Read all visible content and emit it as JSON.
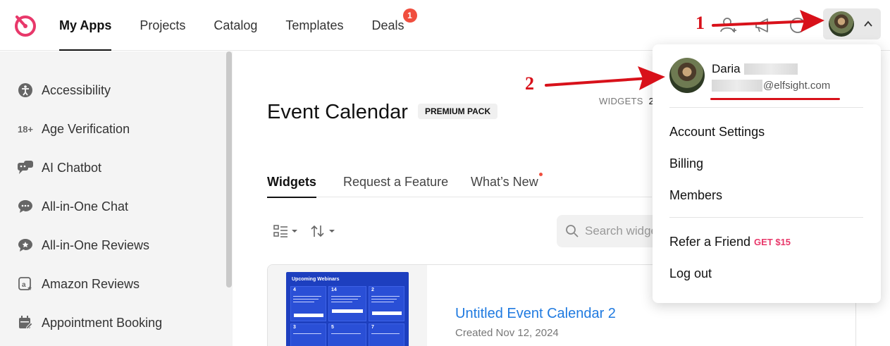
{
  "topbar": {
    "nav": [
      {
        "label": "My Apps",
        "active": true
      },
      {
        "label": "Projects",
        "active": false
      },
      {
        "label": "Catalog",
        "active": false
      },
      {
        "label": "Templates",
        "active": false
      },
      {
        "label": "Deals",
        "active": false
      }
    ],
    "deals_badge": "1",
    "icons": [
      "logo-icon",
      "add-user-icon",
      "megaphone-icon",
      "help-icon",
      "chevron-up-icon"
    ],
    "accent_color": "#e8386a"
  },
  "sidebar": {
    "items": [
      {
        "label": "Accessibility",
        "icon": "accessibility-icon"
      },
      {
        "label": "Age Verification",
        "icon": "age-18-icon",
        "icon_text": "18+"
      },
      {
        "label": "AI Chatbot",
        "icon": "chatbot-icon"
      },
      {
        "label": "All-in-One Chat",
        "icon": "chat-icon"
      },
      {
        "label": "All-in-One Reviews",
        "icon": "reviews-icon"
      },
      {
        "label": "Amazon Reviews",
        "icon": "amazon-icon"
      },
      {
        "label": "Appointment Booking",
        "icon": "calendar-edit-icon"
      }
    ]
  },
  "main": {
    "title": "Event Calendar",
    "pack_badge": "PREMIUM PACK",
    "widgets_label": "WIDGETS",
    "widgets_count": "2",
    "tabs": [
      {
        "label": "Widgets",
        "active": true
      },
      {
        "label": "Request a Feature",
        "active": false
      },
      {
        "label": "What’s New",
        "active": false,
        "dot": true
      }
    ],
    "search_placeholder": "Search widgets",
    "widget_card": {
      "title": "Untitled Event Calendar 2",
      "created": "Created Nov 12, 2024",
      "thumb_title": "Upcoming Webinars",
      "thumb_days": [
        "4",
        "14",
        "2",
        "3",
        "5",
        "7"
      ]
    }
  },
  "account_menu": {
    "name": "Daria",
    "email_domain": "@elfsight.com",
    "items": [
      "Account Settings",
      "Billing",
      "Members"
    ],
    "refer_label": "Refer a Friend",
    "refer_promo": "GET $15",
    "logout_label": "Log out"
  },
  "annotations": {
    "marker_1": "1",
    "marker_2": "2",
    "color": "#d8111a"
  }
}
